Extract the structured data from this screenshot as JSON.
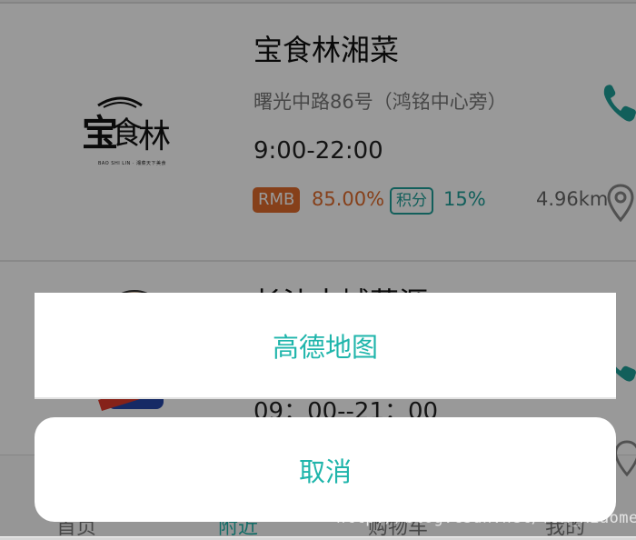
{
  "shops": [
    {
      "name": "宝食林湘菜",
      "address": "曙光中路86号（鸿铭中心旁）",
      "hours": "9:00-22:00",
      "rmb_label": "RMB",
      "rmb_value": "85.00%",
      "points_label": "积分",
      "points_value": "15%",
      "distance": "4.96km",
      "logo_text": "宝食林",
      "logo_sub": "BAO SHI LIN · 湘菜天下美食"
    },
    {
      "name": "长沙古城菜源",
      "hours": "09：00--21：00"
    }
  ],
  "tabs": [
    {
      "label": "首页"
    },
    {
      "label": "附近"
    },
    {
      "label": "购物车"
    },
    {
      "label": "我的"
    }
  ],
  "action_sheet": {
    "option": "高德地图",
    "cancel": "取消"
  },
  "watermark": "http://blog.csdn.net/fsx_xiaomei",
  "colors": {
    "accent": "#1fb5ab",
    "rmb": "#e06b2c",
    "points": "#1f9f98"
  }
}
